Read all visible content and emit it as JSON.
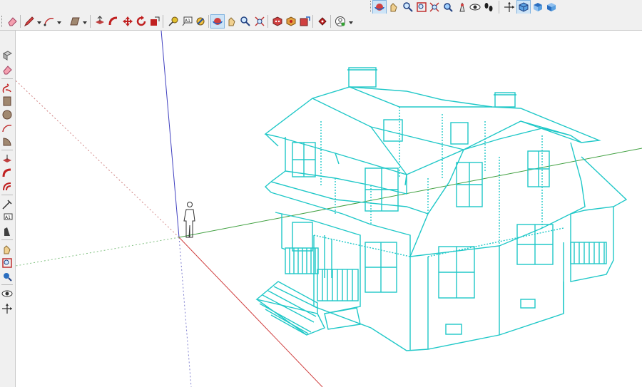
{
  "app": {
    "title": ""
  },
  "colors": {
    "toolbar_bg": "#f0f0f0",
    "active_button": "#cde4f7",
    "model_lines": "#20c8c8",
    "axis_red": "#d04040",
    "axis_green": "#40a040",
    "axis_blue": "#4040c0"
  },
  "toolbar_top": {
    "tools": [
      "zone-object-icon",
      "paint-bucket-icon",
      "zoom-icon",
      "zoom-window-icon",
      "zoom-extents-icon",
      "look-around-icon",
      "position-camera-icon",
      "walk-icon",
      "axes-icon",
      "iso-view-icon",
      "top-view-icon",
      "front-view-icon"
    ]
  },
  "toolbar_main": {
    "tools": [
      "eraser-icon",
      "pencil-icon",
      "arc-icon",
      "rectangle-icon",
      "push-pull-icon",
      "follow-me-icon",
      "move-icon",
      "rotate-icon",
      "scale-icon",
      "tape-measure-icon",
      "text-icon",
      "protractor-icon",
      "orbit-icon",
      "pan-icon",
      "zoom-tool-icon",
      "zoom-extents-tool-icon",
      "components-icon",
      "materials-icon",
      "warehouse-icon",
      "extension-icon",
      "user-account-icon"
    ]
  },
  "toolbar_left": {
    "tools": [
      "select-icon",
      "eraser-icon",
      "freehand-icon",
      "rectangle-icon",
      "circle-icon",
      "arc-icon",
      "pie-icon",
      "push-pull-icon",
      "follow-me-icon",
      "offset-icon",
      "tape-measure-icon",
      "text-icon",
      "section-plane-icon",
      "orbit-icon",
      "zoom-window-icon",
      "position-camera-icon",
      "look-around-icon",
      "walk-icon"
    ]
  },
  "viewport": {
    "scene": "house-wireframe-model",
    "human_figure": "scale-figure-icon"
  }
}
